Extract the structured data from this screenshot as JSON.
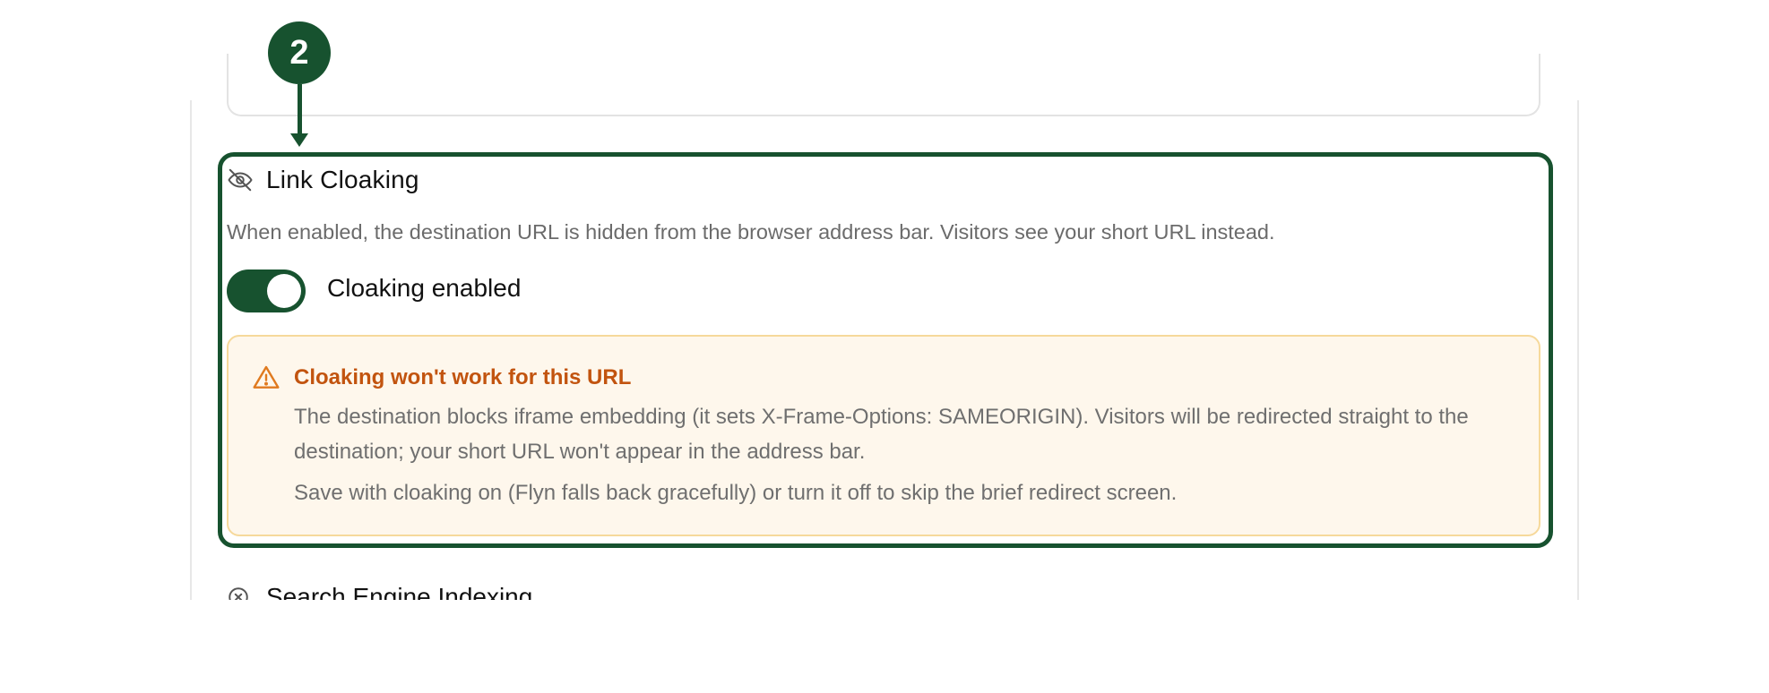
{
  "annotation": {
    "step_number": "2"
  },
  "section": {
    "icon": "eye-off-icon",
    "title": "Link Cloaking",
    "description": "When enabled, the destination URL is hidden from the browser address bar. Visitors see your short URL instead."
  },
  "toggle": {
    "label": "Cloaking enabled",
    "state": "on",
    "color": "#17522f"
  },
  "warning": {
    "icon": "warning-triangle-icon",
    "title": "Cloaking won't work for this URL",
    "body": "The destination blocks iframe embedding (it sets X-Frame-Options: SAMEORIGIN). Visitors will be redirected straight to the destination; your short URL won't appear in the address bar.",
    "note": "Save with cloaking on (Flyn falls back gracefully) or turn it off to skip the brief redirect screen.",
    "title_color": "#c2540f",
    "background": "#fef7ec",
    "border": "#f6d99b"
  },
  "next_section": {
    "icon": "circle-x-icon",
    "title": "Search Engine Indexing"
  },
  "colors": {
    "accent": "#17522f"
  }
}
